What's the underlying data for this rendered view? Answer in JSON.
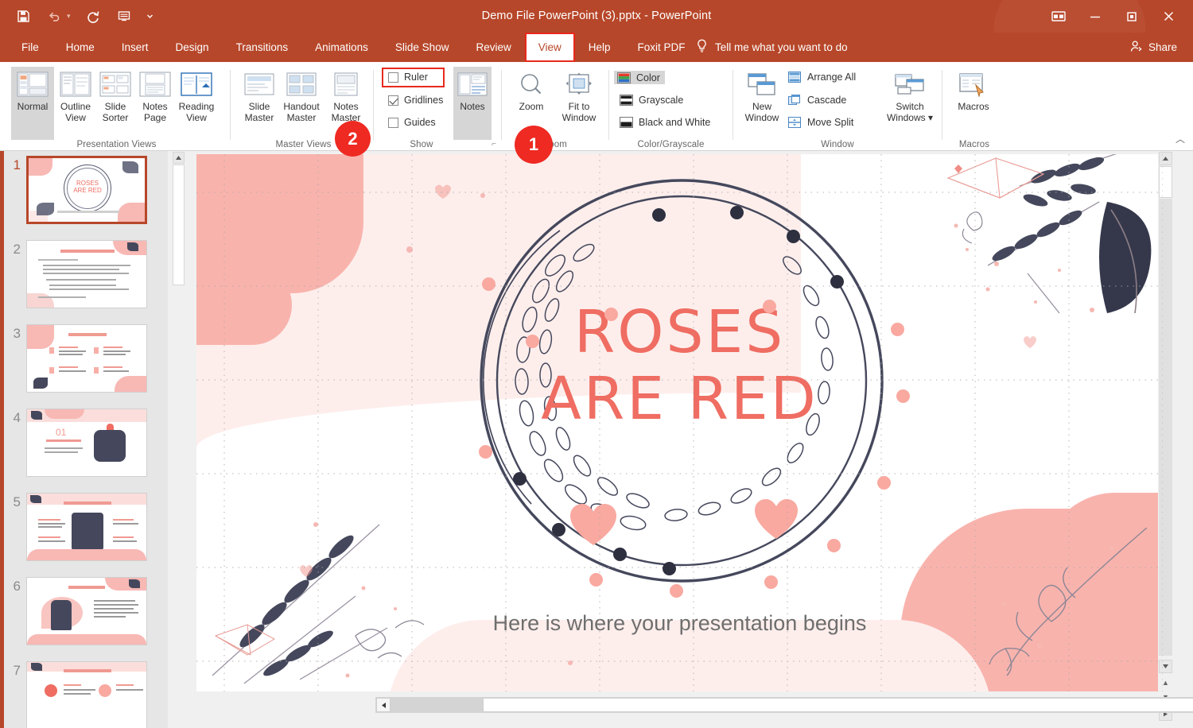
{
  "window": {
    "title": "Demo File PowerPoint (3).pptx  -  PowerPoint",
    "qat": [
      {
        "name": "save-icon",
        "label": "Save"
      },
      {
        "name": "undo-icon",
        "label": "Undo"
      },
      {
        "name": "redo-icon",
        "label": "Redo"
      },
      {
        "name": "start-from-beginning-icon",
        "label": "Start From Beginning"
      },
      {
        "name": "customize-qat-icon",
        "label": "Customize Quick Access Toolbar"
      }
    ],
    "controls": [
      {
        "name": "ribbon-display-options-icon",
        "label": "Ribbon Display Options"
      },
      {
        "name": "minimize-icon",
        "label": "Minimize"
      },
      {
        "name": "restore-icon",
        "label": "Restore Down"
      },
      {
        "name": "close-icon",
        "label": "Close"
      }
    ]
  },
  "tabs": [
    {
      "label": "File",
      "active": false
    },
    {
      "label": "Home",
      "active": false
    },
    {
      "label": "Insert",
      "active": false
    },
    {
      "label": "Design",
      "active": false
    },
    {
      "label": "Transitions",
      "active": false
    },
    {
      "label": "Animations",
      "active": false
    },
    {
      "label": "Slide Show",
      "active": false
    },
    {
      "label": "Review",
      "active": false
    },
    {
      "label": "View",
      "active": true
    },
    {
      "label": "Help",
      "active": false
    },
    {
      "label": "Foxit PDF",
      "active": false
    }
  ],
  "tellme": {
    "label": "Tell me what you want to do",
    "icon": "lightbulb-icon"
  },
  "share": {
    "label": "Share",
    "icon": "share-person-icon"
  },
  "ribbon": {
    "groups": [
      {
        "name": "presentation-views",
        "label": "Presentation Views",
        "buttons": [
          {
            "label1": "Normal",
            "label2": "",
            "selected": true
          },
          {
            "label1": "Outline",
            "label2": "View",
            "selected": false
          },
          {
            "label1": "Slide",
            "label2": "Sorter",
            "selected": false
          },
          {
            "label1": "Notes",
            "label2": "Page",
            "selected": false
          },
          {
            "label1": "Reading",
            "label2": "View",
            "selected": false
          }
        ]
      },
      {
        "name": "master-views",
        "label": "Master Views",
        "buttons": [
          {
            "label1": "Slide",
            "label2": "Master",
            "selected": false
          },
          {
            "label1": "Handout",
            "label2": "Master",
            "selected": false
          },
          {
            "label1": "Notes",
            "label2": "Master",
            "selected": false
          }
        ]
      },
      {
        "name": "show",
        "label": "Show",
        "checkboxes": [
          {
            "label": "Ruler",
            "checked": false,
            "highlighted": true
          },
          {
            "label": "Gridlines",
            "checked": true,
            "highlighted": false
          },
          {
            "label": "Guides",
            "checked": false,
            "highlighted": false
          }
        ],
        "buttons": [
          {
            "label1": "Notes",
            "label2": "",
            "selected": true
          }
        ],
        "dialog_launcher": true
      },
      {
        "name": "zoom",
        "label": "Zoom",
        "buttons": [
          {
            "label1": "Zoom",
            "label2": "",
            "selected": false
          },
          {
            "label1": "Fit to",
            "label2": "Window",
            "selected": false
          }
        ]
      },
      {
        "name": "color-grayscale",
        "label": "Color/Grayscale",
        "options": [
          {
            "label": "Color",
            "selected": true
          },
          {
            "label": "Grayscale",
            "selected": false
          },
          {
            "label": "Black and White",
            "selected": false
          }
        ]
      },
      {
        "name": "window",
        "label": "Window",
        "buttons": [
          {
            "label1": "New",
            "label2": "Window",
            "selected": false
          },
          {
            "label1": "Switch",
            "label2": "Windows ▾",
            "selected": false
          }
        ],
        "items": [
          {
            "label": "Arrange All"
          },
          {
            "label": "Cascade"
          },
          {
            "label": "Move Split"
          }
        ]
      },
      {
        "name": "macros",
        "label": "Macros",
        "buttons": [
          {
            "label1": "Macros",
            "label2": "",
            "selected": false
          }
        ]
      }
    ]
  },
  "callouts": [
    {
      "number": "1",
      "target": "zoom-group"
    },
    {
      "number": "2",
      "target": "ruler-checkbox"
    }
  ],
  "slide_panel": {
    "slides": [
      {
        "number": "1",
        "active": true
      },
      {
        "number": "2",
        "active": false
      },
      {
        "number": "3",
        "active": false
      },
      {
        "number": "4",
        "active": false
      },
      {
        "number": "5",
        "active": false
      },
      {
        "number": "6",
        "active": false
      },
      {
        "number": "7",
        "active": false
      }
    ]
  },
  "slide": {
    "title_line1": "ROSES",
    "title_line2": "ARE RED",
    "subtitle": "Here is where your presentation begins",
    "title_color": "#ef6d62",
    "subtitle_color": "#6e6e6e",
    "accent_pink": "#f9a9a0",
    "pale_pink": "#fbe4e1",
    "dark_ink": "#2e3040"
  },
  "colors": {
    "ribbon_accent": "#b7472a",
    "highlight_red": "#e8291c",
    "badge_red": "#ee2a22"
  }
}
